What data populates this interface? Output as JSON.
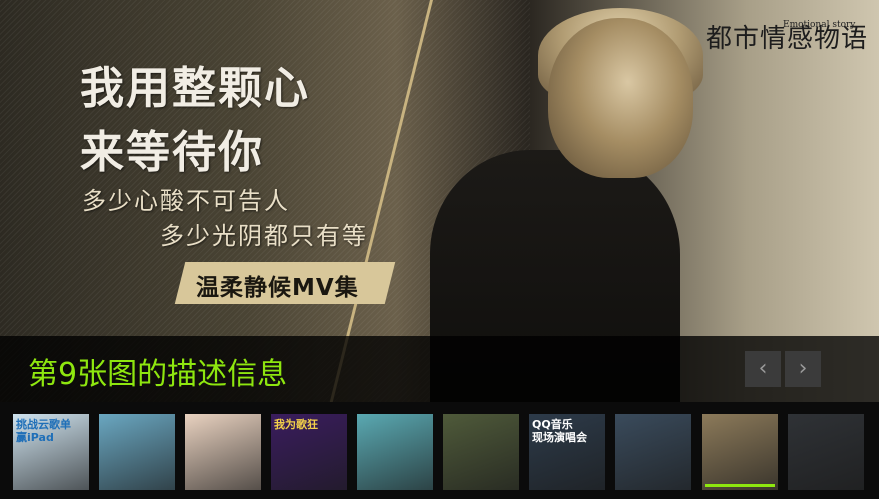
{
  "banner": {
    "logo": "都市情感物语",
    "logo_sub": "Emotional story",
    "headline_1": "我用整颗心",
    "headline_2": "来等待你",
    "sub_1": "多少心酸不可告人",
    "sub_2": "多少光阴都只有等",
    "tag": "温柔静候MV集"
  },
  "caption": {
    "text": "第9张图的描述信息",
    "prev_icon": "‹",
    "next_icon": "›"
  },
  "thumbnails": [
    {
      "label": "挑战云歌单\n赢iPad",
      "bg": "#cfe3ef",
      "fg": "#1f6fb8"
    },
    {
      "label": "",
      "bg": "#6aa7c1",
      "fg": "#fff"
    },
    {
      "label": "",
      "bg": "#e9d2c0",
      "fg": "#333"
    },
    {
      "label": "我为歌狂",
      "bg": "#3a1d5e",
      "fg": "#f2d04a"
    },
    {
      "label": "",
      "bg": "#5aa9b2",
      "fg": "#fff"
    },
    {
      "label": "",
      "bg": "#4f5a3a",
      "fg": "#fff"
    },
    {
      "label": "QQ音乐\n现场演唱会",
      "bg": "#2d3b4a",
      "fg": "#ffffff"
    },
    {
      "label": "",
      "bg": "#3a4b5c",
      "fg": "#fff"
    },
    {
      "label": "",
      "bg": "#8c7a5a",
      "fg": "#fff",
      "active": true
    },
    {
      "label": "",
      "bg": "#2f3236",
      "fg": "#fff"
    }
  ]
}
